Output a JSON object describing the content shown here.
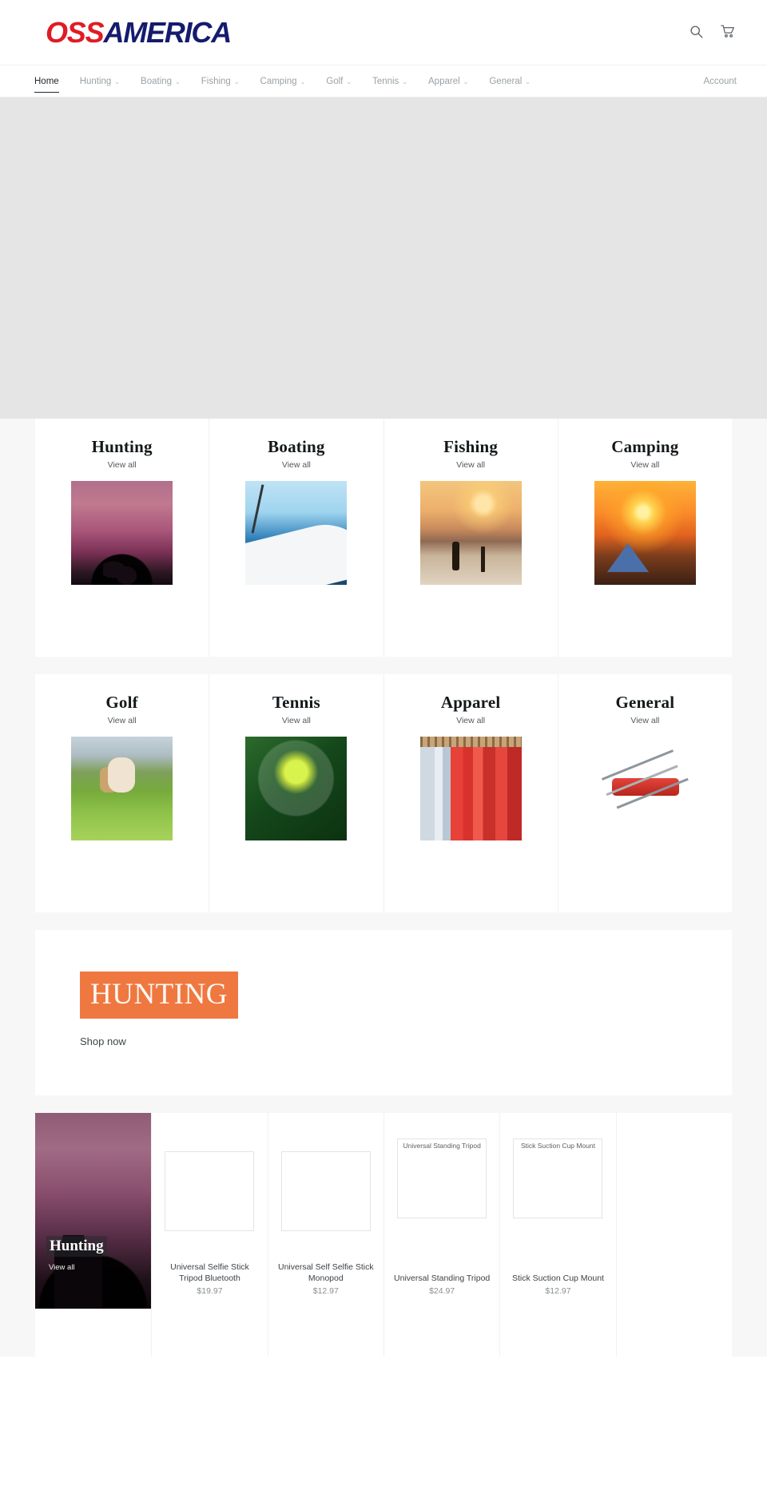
{
  "header": {
    "logo_primary": "OSS",
    "logo_secondary": "AMERICA",
    "search_icon": "search-icon",
    "cart_icon": "cart-icon"
  },
  "nav": {
    "items": [
      {
        "label": "Home",
        "has_caret": false,
        "active": true
      },
      {
        "label": "Hunting",
        "has_caret": true,
        "active": false
      },
      {
        "label": "Boating",
        "has_caret": true,
        "active": false
      },
      {
        "label": "Fishing",
        "has_caret": true,
        "active": false
      },
      {
        "label": "Camping",
        "has_caret": true,
        "active": false
      },
      {
        "label": "Golf",
        "has_caret": true,
        "active": false
      },
      {
        "label": "Tennis",
        "has_caret": true,
        "active": false
      },
      {
        "label": "Apparel",
        "has_caret": true,
        "active": false
      },
      {
        "label": "General",
        "has_caret": true,
        "active": false
      }
    ],
    "caret_glyph": "⌄",
    "account_label": "Account"
  },
  "collections_row_1": [
    {
      "title": "Hunting",
      "view_all": "View all",
      "thumb": "th-hunting"
    },
    {
      "title": "Boating",
      "view_all": "View all",
      "thumb": "th-boating"
    },
    {
      "title": "Fishing",
      "view_all": "View all",
      "thumb": "th-fishing"
    },
    {
      "title": "Camping",
      "view_all": "View all",
      "thumb": "th-camping"
    }
  ],
  "collections_row_2": [
    {
      "title": "Golf",
      "view_all": "View all",
      "thumb": "th-golf"
    },
    {
      "title": "Tennis",
      "view_all": "View all",
      "thumb": "th-tennis"
    },
    {
      "title": "Apparel",
      "view_all": "View all",
      "thumb": "th-apparel"
    },
    {
      "title": "General",
      "view_all": "View all",
      "thumb": "th-general"
    }
  ],
  "promo": {
    "badge_text": "HUNTING",
    "badge_color": "#EF7840",
    "cta_label": "Shop now"
  },
  "product_section": {
    "promo_tile": {
      "title": "Hunting",
      "subtitle": "View all"
    },
    "products": [
      {
        "image_caption": "",
        "title": "Universal Selfie Stick Tripod Bluetooth",
        "price": "$19.97"
      },
      {
        "image_caption": "",
        "title": "Universal Self Selfie Stick Monopod",
        "price": "$12.97"
      },
      {
        "image_caption": "Universal Standing Tripod",
        "title": "Universal Standing Tripod",
        "price": "$24.97"
      },
      {
        "image_caption": "Stick Suction Cup Mount",
        "title": "Stick Suction Cup Mount",
        "price": "$12.97"
      }
    ]
  }
}
